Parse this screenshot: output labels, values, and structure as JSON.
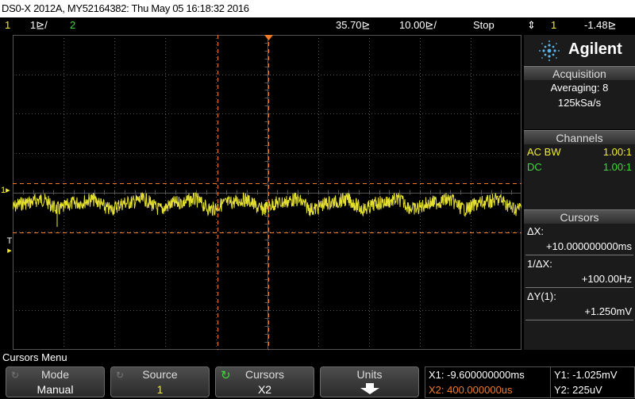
{
  "title": "DS0-X 2012A, MY52164382: Thu May 05 16:18:32 2016",
  "status": {
    "ch1_num": "1",
    "ch1_scale": "1⊵/",
    "ch2_num": "2",
    "horiz_pos": "35.70⊵",
    "time_div": "10.00⊵/",
    "run_state": "Stop",
    "trigger_source": "1",
    "trigger_level": "-1.48⊵"
  },
  "brand": {
    "name": "Agilent"
  },
  "acquisition": {
    "header": "Acquisition",
    "mode": "Averaging: 8",
    "sample_rate": "125kSa/s"
  },
  "channels": {
    "header": "Channels",
    "rows": [
      {
        "label": "AC BW",
        "value": "1.00:1"
      },
      {
        "label": "DC",
        "value": "1.00:1"
      }
    ]
  },
  "cursors": {
    "header": "Cursors",
    "dx_label": "ΔX:",
    "dx_value": "+10.000000000ms",
    "inv_dx_label": "1/ΔX:",
    "inv_dx_value": "+100.00Hz",
    "dy_label": "ΔY(1):",
    "dy_value": "+1.250mV"
  },
  "screen_markers": {
    "ch1_marker": "1",
    "trigger_marker": "T"
  },
  "menu": {
    "title": "Cursors Menu",
    "softkeys": [
      {
        "name": "Mode",
        "value": "Manual"
      },
      {
        "name": "Source",
        "value": "1"
      },
      {
        "name": "Cursors",
        "value": "X2"
      },
      {
        "name": "Units",
        "value": ""
      }
    ]
  },
  "readout": {
    "x1": "X1: -9.600000000ms",
    "x2": "X2: 400.000000us",
    "y1": "Y1: -1.025mV",
    "y2": "Y2: 225uV"
  },
  "colors": {
    "ch1": "#f1ec33",
    "ch2": "#3ddc3a",
    "cursor": "#f07a28",
    "grid": "#555555"
  },
  "icons": {
    "brand_logo": "agilent-spark-icon",
    "cursors_knob": "rotate-knob-icon",
    "units_arrow": "down-arrow-icon",
    "trigger_edge": "rising-edge-icon"
  }
}
